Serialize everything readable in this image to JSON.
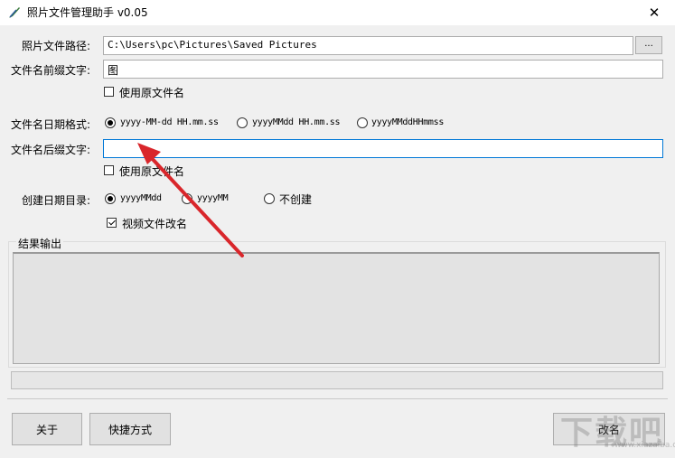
{
  "window": {
    "title": "照片文件管理助手 v0.05",
    "close_glyph": "✕"
  },
  "form": {
    "path_label": "照片文件路径:",
    "path_value": "C:\\Users\\pc\\Pictures\\Saved Pictures",
    "browse_label": "...",
    "prefix_label": "文件名前缀文字:",
    "prefix_value": "图",
    "prefix_use_original": "使用原文件名",
    "date_format_label": "文件名日期格式:",
    "date_formats": [
      "yyyy-MM-dd HH.mm.ss",
      "yyyyMMdd HH.mm.ss",
      "yyyyMMddHHmmss"
    ],
    "suffix_label": "文件名后缀文字:",
    "suffix_value": "",
    "suffix_use_original": "使用原文件名",
    "date_dir_label": "创建日期目录:",
    "date_dirs": [
      "yyyyMMdd",
      "yyyyMM",
      "不创建"
    ],
    "video_rename": "视频文件改名"
  },
  "results": {
    "label": "结果输出"
  },
  "buttons": {
    "about": "关于",
    "shortcut": "快捷方式",
    "rename": "改名"
  },
  "watermark": {
    "text": "下载吧",
    "sub": "www.xiazaiba.com"
  },
  "colors": {
    "focus_border": "#0078d7",
    "arrow": "#d9262b"
  }
}
